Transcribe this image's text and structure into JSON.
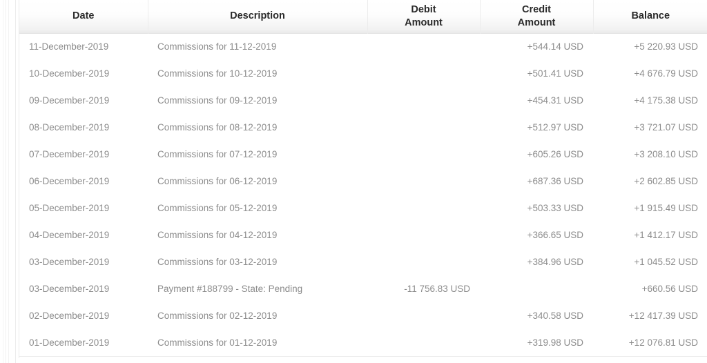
{
  "table": {
    "name": "account-statement-ledger",
    "columns": [
      {
        "key": "date",
        "label": "Date",
        "align": "left"
      },
      {
        "key": "desc",
        "label": "Description",
        "align": "left"
      },
      {
        "key": "debit",
        "label": "Debit\nAmount",
        "align": "right"
      },
      {
        "key": "credit",
        "label": "Credit\nAmount",
        "align": "right"
      },
      {
        "key": "balance",
        "label": "Balance",
        "align": "right"
      }
    ],
    "rows": [
      {
        "date": "11-December-2019",
        "desc": "Commissions for 11-12-2019",
        "debit": "",
        "credit": "+544.14 USD",
        "balance": "+5 220.93 USD"
      },
      {
        "date": "10-December-2019",
        "desc": "Commissions for 10-12-2019",
        "debit": "",
        "credit": "+501.41 USD",
        "balance": "+4 676.79 USD"
      },
      {
        "date": "09-December-2019",
        "desc": "Commissions for 09-12-2019",
        "debit": "",
        "credit": "+454.31 USD",
        "balance": "+4 175.38 USD"
      },
      {
        "date": "08-December-2019",
        "desc": "Commissions for 08-12-2019",
        "debit": "",
        "credit": "+512.97 USD",
        "balance": "+3 721.07 USD"
      },
      {
        "date": "07-December-2019",
        "desc": "Commissions for 07-12-2019",
        "debit": "",
        "credit": "+605.26 USD",
        "balance": "+3 208.10 USD"
      },
      {
        "date": "06-December-2019",
        "desc": "Commissions for 06-12-2019",
        "debit": "",
        "credit": "+687.36 USD",
        "balance": "+2 602.85 USD"
      },
      {
        "date": "05-December-2019",
        "desc": "Commissions for 05-12-2019",
        "debit": "",
        "credit": "+503.33 USD",
        "balance": "+1 915.49 USD"
      },
      {
        "date": "04-December-2019",
        "desc": "Commissions for 04-12-2019",
        "debit": "",
        "credit": "+366.65 USD",
        "balance": "+1 412.17 USD"
      },
      {
        "date": "03-December-2019",
        "desc": "Commissions for 03-12-2019",
        "debit": "",
        "credit": "+384.96 USD",
        "balance": "+1 045.52 USD"
      },
      {
        "date": "03-December-2019",
        "desc": "Payment #188799 - State: Pending",
        "debit": "-11 756.83 USD",
        "credit": "",
        "balance": "+660.56 USD"
      },
      {
        "date": "02-December-2019",
        "desc": "Commissions for 02-12-2019",
        "debit": "",
        "credit": "+340.58 USD",
        "balance": "+12 417.39 USD"
      },
      {
        "date": "01-December-2019",
        "desc": "Commissions for 01-12-2019",
        "debit": "",
        "credit": "+319.98 USD",
        "balance": "+12 076.81 USD"
      }
    ]
  },
  "colors": {
    "header_text": "#2a2a2a",
    "cell_text": "#8c8c8c",
    "divider": "#ececec",
    "header_gradient_bottom": "#eaeaea",
    "background": "#ffffff"
  }
}
